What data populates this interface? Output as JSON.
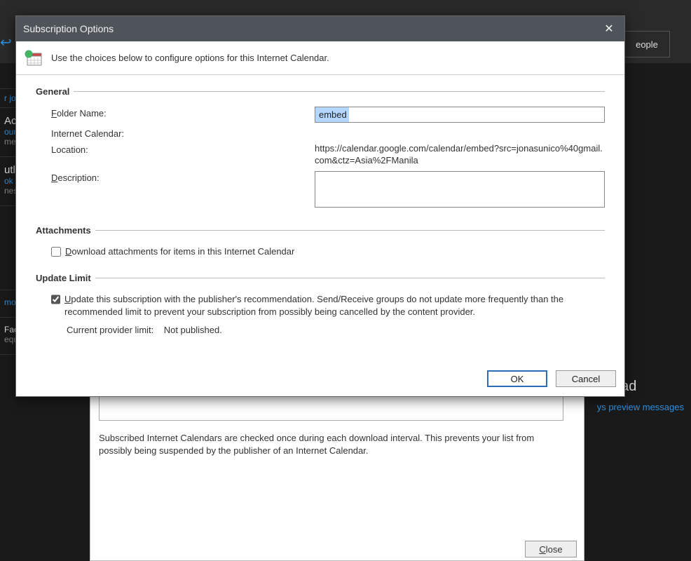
{
  "background": {
    "people_button": "eople",
    "arrow_glyph": "↩",
    "sidebar": {
      "item_orjo": "r jo",
      "ac_title": "Ac",
      "ac_link": "our",
      "ac_sub": "me",
      "outlook_title": "utl",
      "outlook_link": "ok",
      "outlook_sub": "nes",
      "removed_link": "moved the ca...",
      "facebook_line": "Facebook ac...",
      "facebook_sub": "equest to reset"
    },
    "behind_text": "Subscribed Internet Calendars are checked once during each download interval. This prevents your list from possibly being suspended by the publisher of an Internet Calendar.",
    "behind_close": "Close",
    "right_msg": "o read",
    "right_link": "ys preview messages"
  },
  "dialog": {
    "title": "Subscription Options",
    "intro": "Use the choices below to configure options for this Internet Calendar.",
    "general": {
      "legend": "General",
      "folder_name_label": "Folder Name:",
      "folder_name_value": "embed",
      "internet_calendar_label": "Internet Calendar:",
      "location_label": "Location:",
      "location_value": "https://calendar.google.com/calendar/embed?src=jonasunico%40gmail.com&ctz=Asia%2FManila",
      "description_label": "Description:",
      "description_value": ""
    },
    "attachments": {
      "legend": "Attachments",
      "download_label": "Download attachments for items in this Internet Calendar",
      "download_checked": false
    },
    "update_limit": {
      "legend": "Update Limit",
      "update_label": "Update this subscription with the publisher's recommendation. Send/Receive groups do not update more frequently than the recommended limit to prevent your subscription from possibly being cancelled by the content provider.",
      "update_checked": true,
      "provider_limit_label": "Current provider limit:",
      "provider_limit_value": "Not published."
    },
    "buttons": {
      "ok": "OK",
      "cancel": "Cancel"
    }
  }
}
